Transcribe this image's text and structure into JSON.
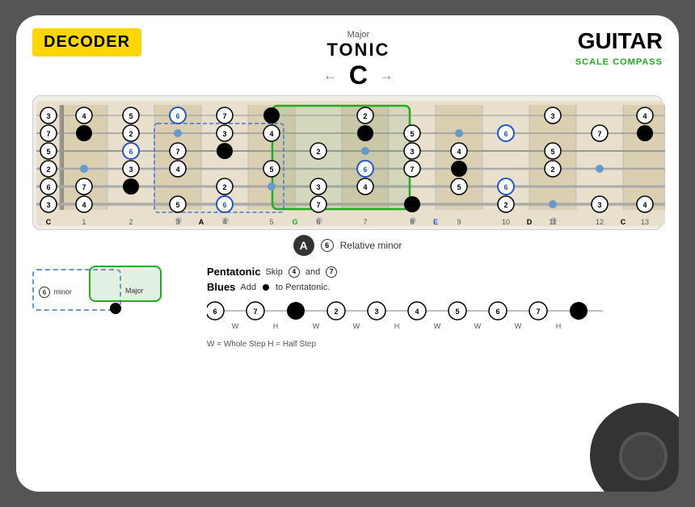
{
  "header": {
    "decoder": "DECODER",
    "tonic_small": "Major",
    "tonic_big": "TONIC",
    "tonic_note": "C",
    "guitar_big": "GUITAR",
    "scale_compass": "SCALE COMPASS"
  },
  "fretboard": {
    "fret_numbers": [
      "",
      "1",
      "2",
      "3",
      "",
      "4",
      "5",
      "",
      "6",
      "7",
      "8",
      "",
      "9",
      "10",
      "",
      "11",
      "12",
      "",
      "13"
    ],
    "bottom_labels": [
      "C",
      "1",
      "2",
      "3",
      "A",
      "4",
      "5",
      "G",
      "6",
      "7",
      "8",
      "E",
      "9",
      "10",
      "D",
      "11",
      "12",
      "C",
      "13"
    ]
  },
  "relative_minor": {
    "letter": "A",
    "num": "6",
    "text": "Relative minor"
  },
  "legend": {
    "minor_label": "minor",
    "major_label": "Major"
  },
  "pentatonic": {
    "name": "Pentatonic",
    "desc": "Skip",
    "skip1": "4",
    "and": "and",
    "skip2": "7"
  },
  "blues": {
    "name": "Blues",
    "desc": "Add",
    "to": "to Pentatonic."
  },
  "scale_notes": [
    "6",
    "7",
    "1",
    "2",
    "3",
    "4",
    "5",
    "6",
    "7",
    "1"
  ],
  "scale_steps": [
    "W",
    "H",
    "W",
    "W",
    "H",
    "W",
    "W",
    "W",
    "H"
  ],
  "wh_legend": "W = Whole Step    H = Half Step"
}
